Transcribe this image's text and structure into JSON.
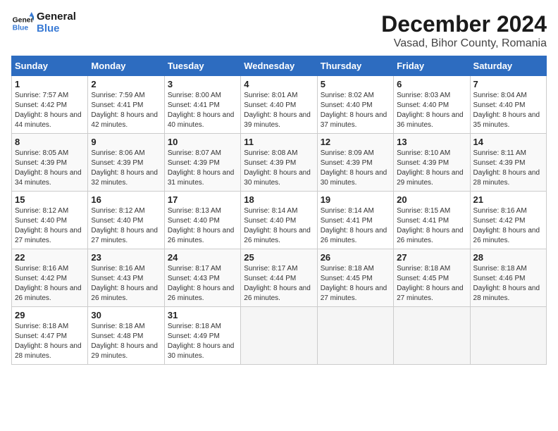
{
  "logo": {
    "line1": "General",
    "line2": "Blue"
  },
  "title": "December 2024",
  "subtitle": "Vasad, Bihor County, Romania",
  "headers": [
    "Sunday",
    "Monday",
    "Tuesday",
    "Wednesday",
    "Thursday",
    "Friday",
    "Saturday"
  ],
  "weeks": [
    [
      {
        "day": "1",
        "sunrise": "7:57 AM",
        "sunset": "4:42 PM",
        "daylight": "8 hours and 44 minutes."
      },
      {
        "day": "2",
        "sunrise": "7:59 AM",
        "sunset": "4:41 PM",
        "daylight": "8 hours and 42 minutes."
      },
      {
        "day": "3",
        "sunrise": "8:00 AM",
        "sunset": "4:41 PM",
        "daylight": "8 hours and 40 minutes."
      },
      {
        "day": "4",
        "sunrise": "8:01 AM",
        "sunset": "4:40 PM",
        "daylight": "8 hours and 39 minutes."
      },
      {
        "day": "5",
        "sunrise": "8:02 AM",
        "sunset": "4:40 PM",
        "daylight": "8 hours and 37 minutes."
      },
      {
        "day": "6",
        "sunrise": "8:03 AM",
        "sunset": "4:40 PM",
        "daylight": "8 hours and 36 minutes."
      },
      {
        "day": "7",
        "sunrise": "8:04 AM",
        "sunset": "4:40 PM",
        "daylight": "8 hours and 35 minutes."
      }
    ],
    [
      {
        "day": "8",
        "sunrise": "8:05 AM",
        "sunset": "4:39 PM",
        "daylight": "8 hours and 34 minutes."
      },
      {
        "day": "9",
        "sunrise": "8:06 AM",
        "sunset": "4:39 PM",
        "daylight": "8 hours and 32 minutes."
      },
      {
        "day": "10",
        "sunrise": "8:07 AM",
        "sunset": "4:39 PM",
        "daylight": "8 hours and 31 minutes."
      },
      {
        "day": "11",
        "sunrise": "8:08 AM",
        "sunset": "4:39 PM",
        "daylight": "8 hours and 30 minutes."
      },
      {
        "day": "12",
        "sunrise": "8:09 AM",
        "sunset": "4:39 PM",
        "daylight": "8 hours and 30 minutes."
      },
      {
        "day": "13",
        "sunrise": "8:10 AM",
        "sunset": "4:39 PM",
        "daylight": "8 hours and 29 minutes."
      },
      {
        "day": "14",
        "sunrise": "8:11 AM",
        "sunset": "4:39 PM",
        "daylight": "8 hours and 28 minutes."
      }
    ],
    [
      {
        "day": "15",
        "sunrise": "8:12 AM",
        "sunset": "4:40 PM",
        "daylight": "8 hours and 27 minutes."
      },
      {
        "day": "16",
        "sunrise": "8:12 AM",
        "sunset": "4:40 PM",
        "daylight": "8 hours and 27 minutes."
      },
      {
        "day": "17",
        "sunrise": "8:13 AM",
        "sunset": "4:40 PM",
        "daylight": "8 hours and 26 minutes."
      },
      {
        "day": "18",
        "sunrise": "8:14 AM",
        "sunset": "4:40 PM",
        "daylight": "8 hours and 26 minutes."
      },
      {
        "day": "19",
        "sunrise": "8:14 AM",
        "sunset": "4:41 PM",
        "daylight": "8 hours and 26 minutes."
      },
      {
        "day": "20",
        "sunrise": "8:15 AM",
        "sunset": "4:41 PM",
        "daylight": "8 hours and 26 minutes."
      },
      {
        "day": "21",
        "sunrise": "8:16 AM",
        "sunset": "4:42 PM",
        "daylight": "8 hours and 26 minutes."
      }
    ],
    [
      {
        "day": "22",
        "sunrise": "8:16 AM",
        "sunset": "4:42 PM",
        "daylight": "8 hours and 26 minutes."
      },
      {
        "day": "23",
        "sunrise": "8:16 AM",
        "sunset": "4:43 PM",
        "daylight": "8 hours and 26 minutes."
      },
      {
        "day": "24",
        "sunrise": "8:17 AM",
        "sunset": "4:43 PM",
        "daylight": "8 hours and 26 minutes."
      },
      {
        "day": "25",
        "sunrise": "8:17 AM",
        "sunset": "4:44 PM",
        "daylight": "8 hours and 26 minutes."
      },
      {
        "day": "26",
        "sunrise": "8:18 AM",
        "sunset": "4:45 PM",
        "daylight": "8 hours and 27 minutes."
      },
      {
        "day": "27",
        "sunrise": "8:18 AM",
        "sunset": "4:45 PM",
        "daylight": "8 hours and 27 minutes."
      },
      {
        "day": "28",
        "sunrise": "8:18 AM",
        "sunset": "4:46 PM",
        "daylight": "8 hours and 28 minutes."
      }
    ],
    [
      {
        "day": "29",
        "sunrise": "8:18 AM",
        "sunset": "4:47 PM",
        "daylight": "8 hours and 28 minutes."
      },
      {
        "day": "30",
        "sunrise": "8:18 AM",
        "sunset": "4:48 PM",
        "daylight": "8 hours and 29 minutes."
      },
      {
        "day": "31",
        "sunrise": "8:18 AM",
        "sunset": "4:49 PM",
        "daylight": "8 hours and 30 minutes."
      },
      null,
      null,
      null,
      null
    ]
  ]
}
